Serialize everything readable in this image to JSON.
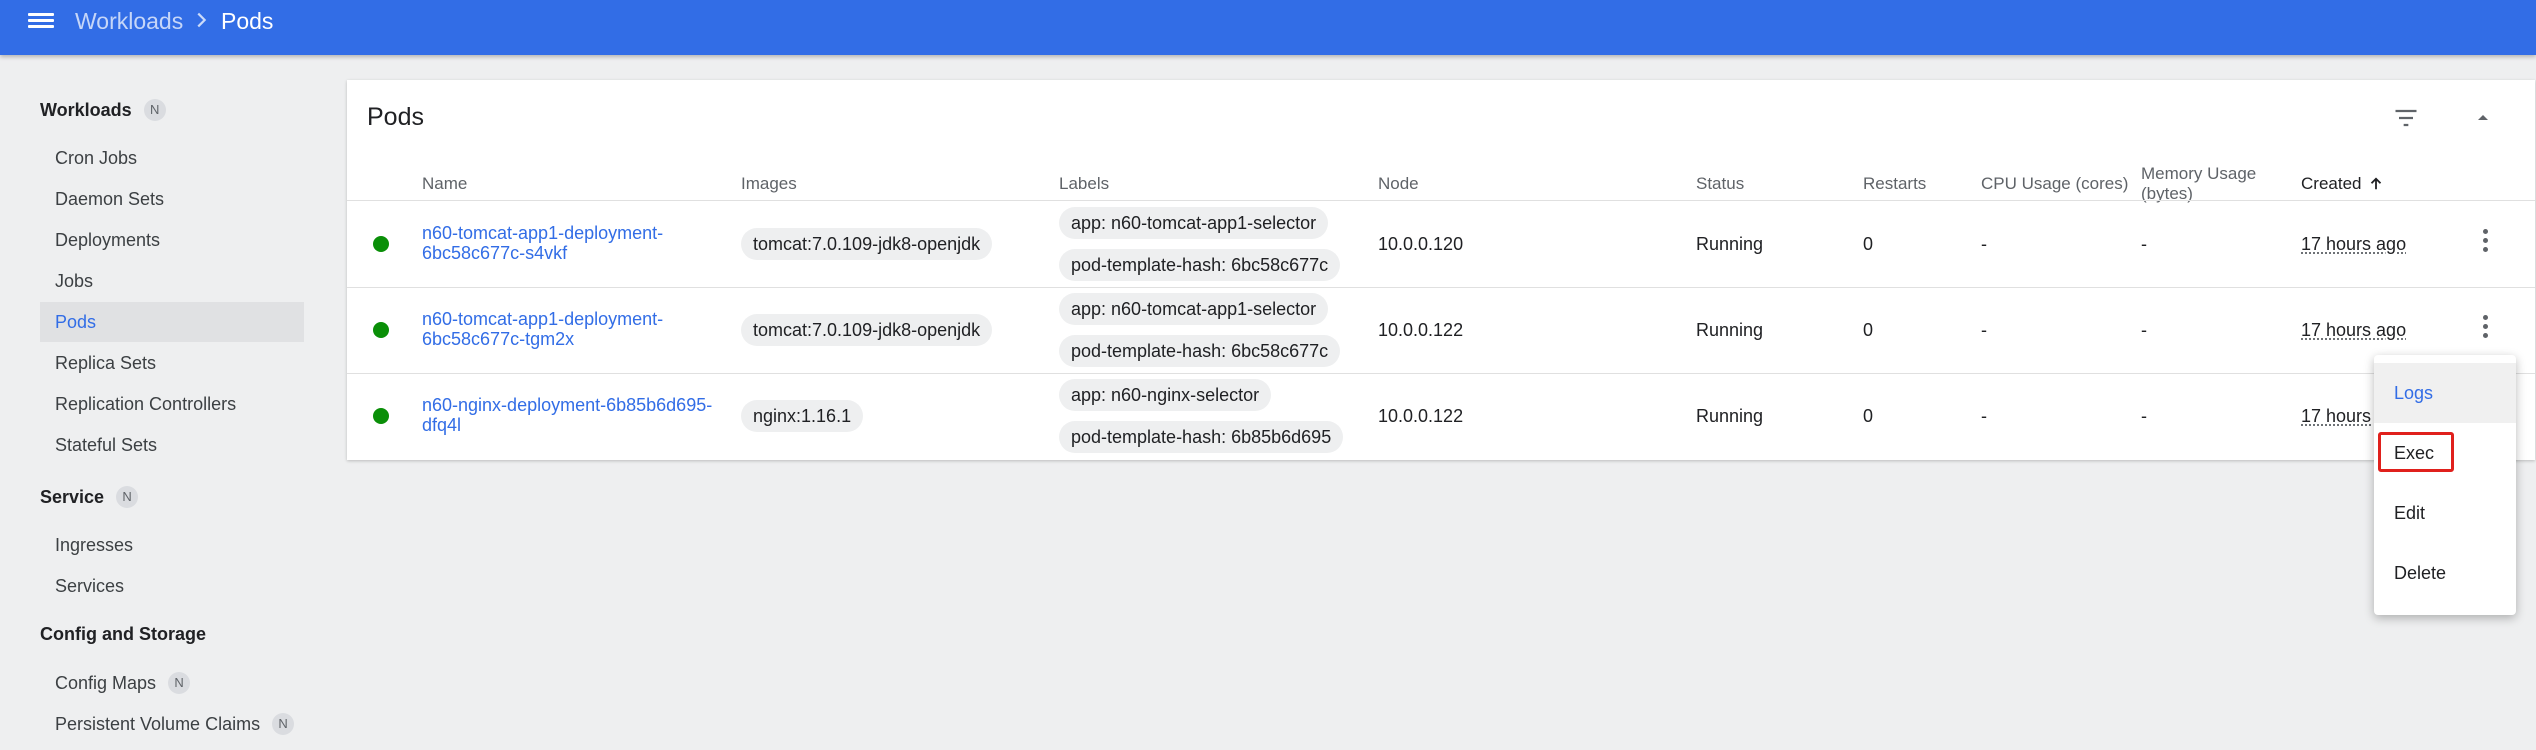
{
  "breadcrumb": {
    "parent": "Workloads",
    "current": "Pods"
  },
  "sidebar": {
    "workloads": {
      "title": "Workloads",
      "badge": "N"
    },
    "workload_items": [
      "Cron Jobs",
      "Daemon Sets",
      "Deployments",
      "Jobs",
      "Pods",
      "Replica Sets",
      "Replication Controllers",
      "Stateful Sets"
    ],
    "active_item": "Pods",
    "service": {
      "title": "Service",
      "badge": "N"
    },
    "service_items": [
      "Ingresses",
      "Services"
    ],
    "config": {
      "title": "Config and Storage"
    },
    "config_items": [
      {
        "label": "Config Maps",
        "badge": "N"
      },
      {
        "label": "Persistent Volume Claims",
        "badge": "N"
      }
    ]
  },
  "card": {
    "title": "Pods",
    "columns": [
      "Name",
      "Images",
      "Labels",
      "Node",
      "Status",
      "Restarts",
      "CPU Usage (cores)",
      "Memory Usage (bytes)",
      "Created"
    ],
    "memory_col_lines": [
      "Memory Usage",
      "(bytes)"
    ],
    "sort_column": "Created",
    "rows": [
      {
        "name_lines": [
          "n60-tomcat-app1-deployment-",
          "6bc58c677c-s4vkf"
        ],
        "image": "tomcat:7.0.109-jdk8-openjdk",
        "labels": [
          "app: n60-tomcat-app1-selector",
          "pod-template-hash: 6bc58c677c"
        ],
        "node": "10.0.0.120",
        "status": "Running",
        "restarts": "0",
        "cpu": "-",
        "memory": "-",
        "created": "17 hours ago",
        "status_color": "#0a8f08"
      },
      {
        "name_lines": [
          "n60-tomcat-app1-deployment-",
          "6bc58c677c-tgm2x"
        ],
        "image": "tomcat:7.0.109-jdk8-openjdk",
        "labels": [
          "app: n60-tomcat-app1-selector",
          "pod-template-hash: 6bc58c677c"
        ],
        "node": "10.0.0.122",
        "status": "Running",
        "restarts": "0",
        "cpu": "-",
        "memory": "-",
        "created": "17 hours ago",
        "status_color": "#0a8f08"
      },
      {
        "name_lines": [
          "n60-nginx-deployment-6b85b6d695-",
          "dfq4l"
        ],
        "image": "nginx:1.16.1",
        "labels": [
          "app: n60-nginx-selector",
          "pod-template-hash: 6b85b6d695"
        ],
        "node": "10.0.0.122",
        "status": "Running",
        "restarts": "0",
        "cpu": "-",
        "memory": "-",
        "created": "17 hours",
        "status_color": "#0a8f08"
      }
    ]
  },
  "context_menu": {
    "items": [
      "Logs",
      "Exec",
      "Edit",
      "Delete"
    ],
    "hovered": "Logs",
    "highlighted_box": "Exec"
  },
  "colors": {
    "topbar": "#326de6",
    "link": "#326de6",
    "running": "#0a8f08",
    "highlight_box": "#e0201c"
  }
}
